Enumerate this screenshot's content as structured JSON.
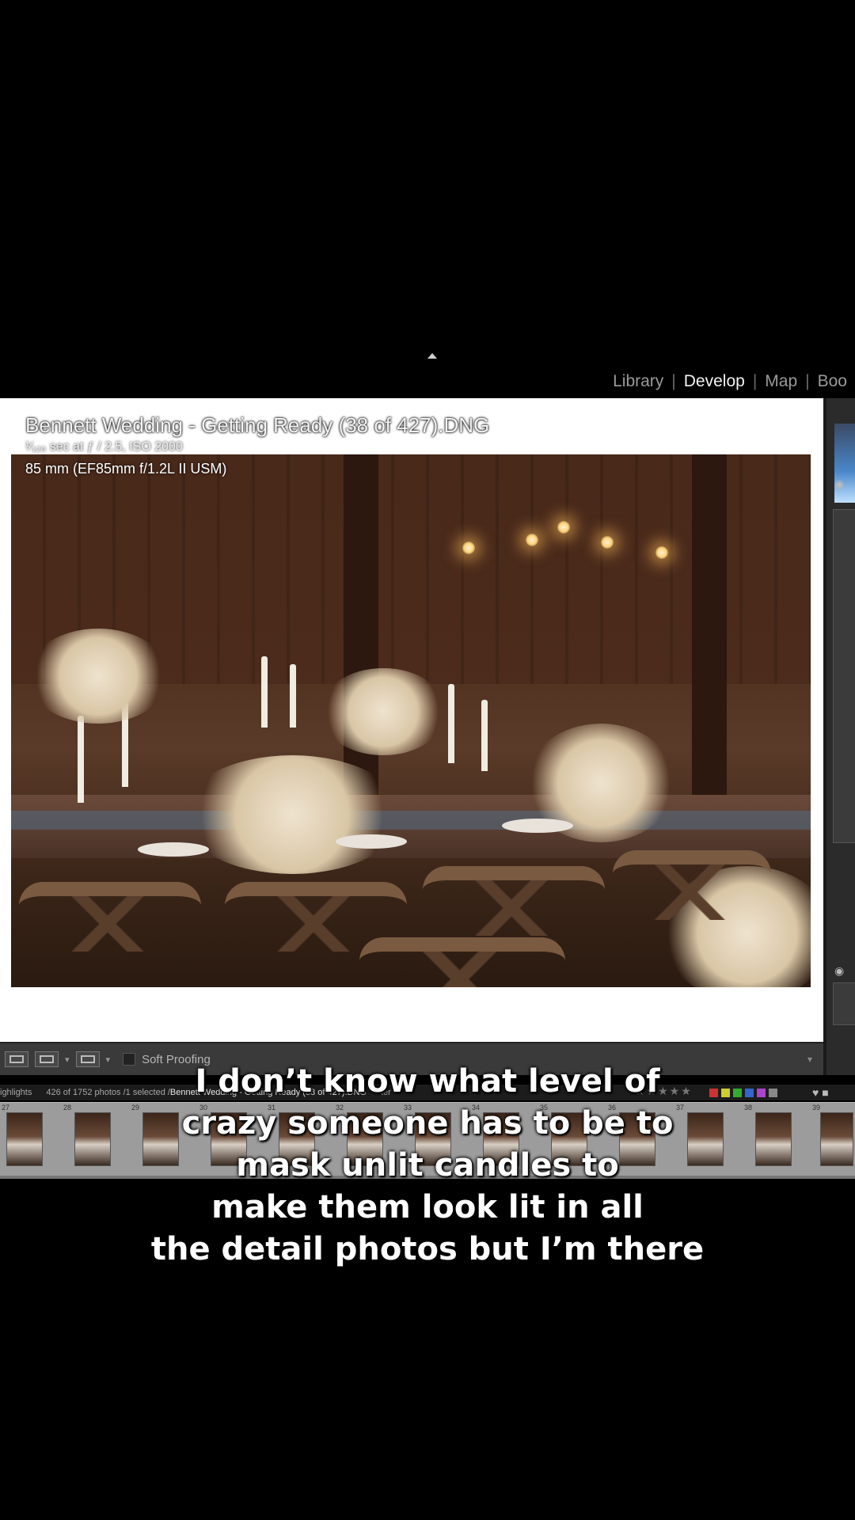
{
  "modules": [
    "Library",
    "Develop",
    "Map",
    "Boo"
  ],
  "active_module": "Develop",
  "photo_info": {
    "filename": "Bennett Wedding - Getting Ready (38 of 427).DNG",
    "exposure": "¹⁄₁₂₀ sec at ƒ / 2.5, ISO 2000",
    "lens": "85 mm (EF85mm f/1.2L II USM)"
  },
  "toolbar": {
    "soft_proofing_label": "Soft Proofing"
  },
  "filmstrip_bar": {
    "source": "ighlights",
    "count": "426 of 1752 photos /1 selected /",
    "file": "Bennett Wedding - Getting Ready (38 of 427).DNG",
    "filter": "ter"
  },
  "thumb_numbers": [
    "27",
    "28",
    "29",
    "30",
    "31",
    "32",
    "33",
    "34",
    "35",
    "36",
    "37",
    "38",
    "39"
  ],
  "caption": [
    "I don’t know what level of",
    "crazy someone has to be to",
    "mask unlit candles to",
    "make them look lit in all",
    "the detail photos but I’m there"
  ],
  "colors": {
    "canvas_background": "#ffffff",
    "panel": "#2b2b2b",
    "filmstrip": "#9c9c9c"
  }
}
